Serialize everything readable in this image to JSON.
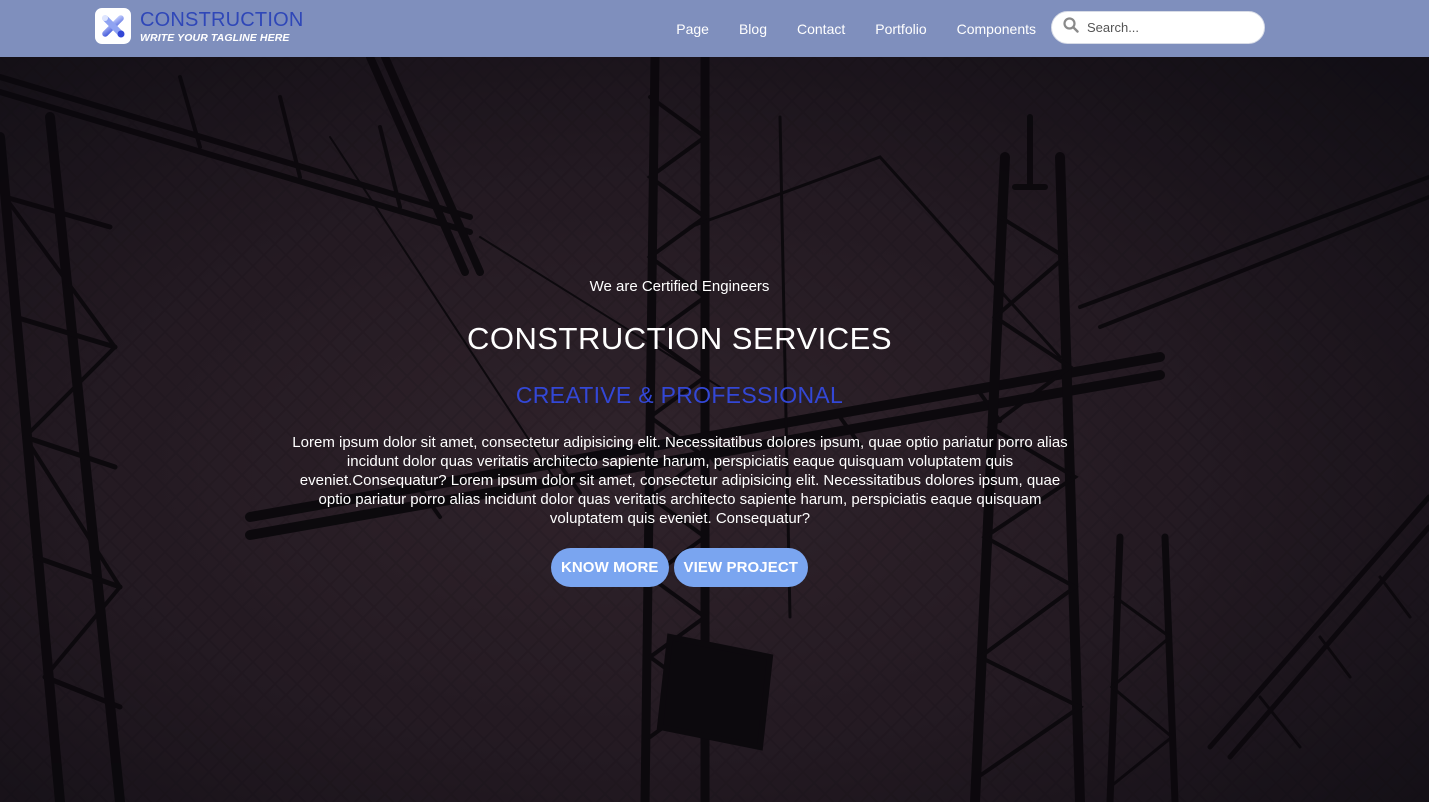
{
  "brand": {
    "logo_icon": "cross-tools-icon",
    "title": "CONSTRUCTION",
    "tagline": "WRITE YOUR TAGLINE HERE"
  },
  "nav": {
    "links": [
      "Page",
      "Blog",
      "Contact",
      "Portfolio",
      "Components"
    ]
  },
  "search": {
    "icon": "search-icon",
    "placeholder": "Search..."
  },
  "hero": {
    "background": "construction-cranes-silhouette",
    "eyebrow": "We are Certified Engineers",
    "title": "CONSTRUCTION SERVICES",
    "subtitle": "CREATIVE & PROFESSIONAL",
    "description": "Lorem ipsum dolor sit amet, consectetur adipisicing elit. Necessitatibus dolores ipsum, quae optio pariatur porro alias incidunt dolor quas veritatis architecto sapiente harum, perspiciatis eaque quisquam voluptatem quis eveniet.Consequatur? Lorem ipsum dolor sit amet, consectetur adipisicing elit. Necessitatibus dolores ipsum, quae optio pariatur porro alias incidunt dolor quas veritatis architecto sapiente harum, perspiciatis eaque quisquam voluptatem quis eveniet. Consequatur?",
    "buttons": {
      "know_more": "KNOW MORE",
      "view_project": "VIEW PROJECT"
    }
  },
  "colors": {
    "navbar": "#7f8fbd",
    "brand_title": "#2f47b8",
    "subtitle": "#3347d6",
    "button": "#7aa5f0"
  }
}
